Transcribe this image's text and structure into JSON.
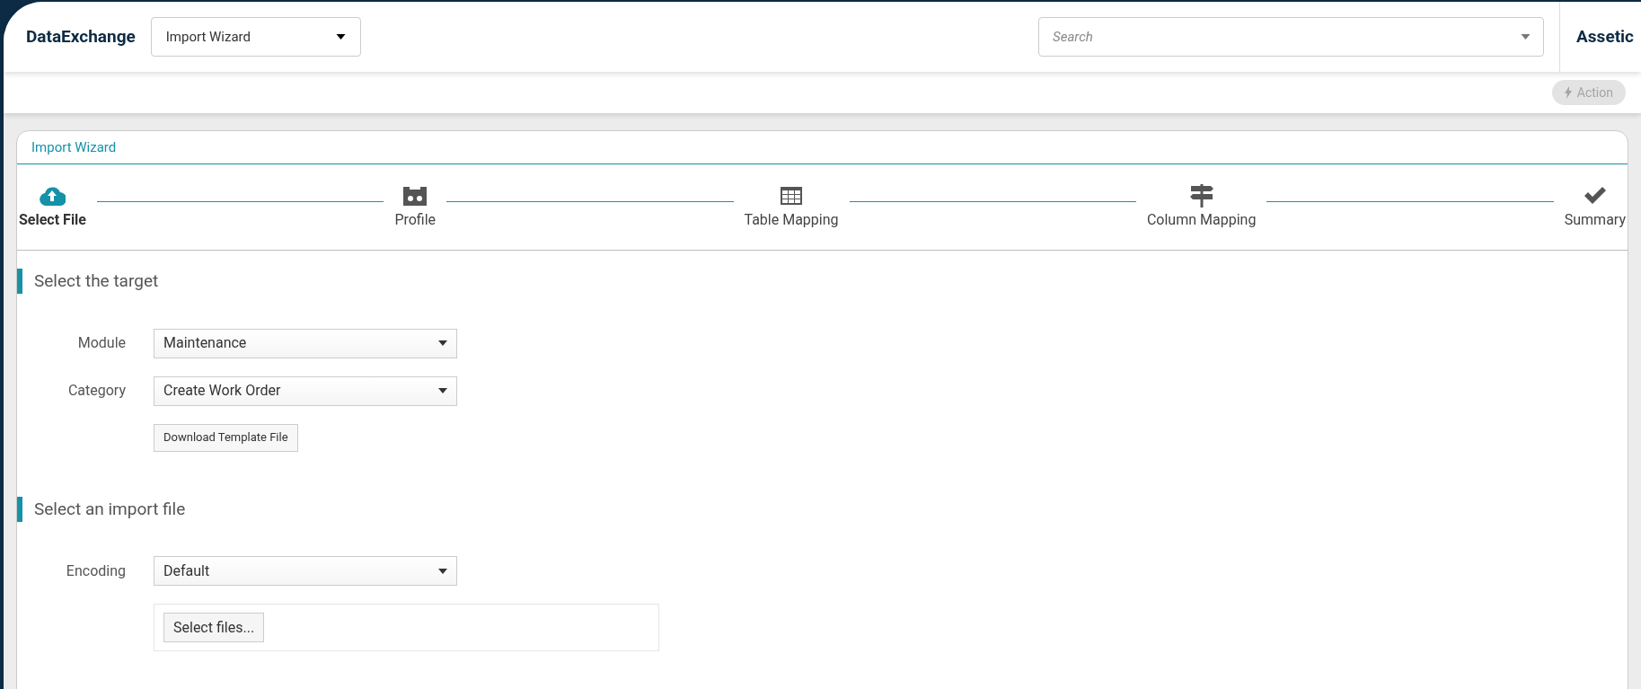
{
  "header": {
    "app_name": "DataExchange",
    "view_select": {
      "value": "Import Wizard"
    },
    "search": {
      "placeholder": "Search"
    },
    "brand": "Assetic"
  },
  "toolbar": {
    "action_button": {
      "label": "Action",
      "disabled": true
    }
  },
  "wizard": {
    "title": "Import Wizard",
    "steps": [
      {
        "label": "Select File",
        "kind": "upload",
        "selected": true
      },
      {
        "label": "Profile",
        "kind": "profile",
        "selected": false
      },
      {
        "label": "Table Mapping",
        "kind": "table",
        "selected": false
      },
      {
        "label": "Column Mapping",
        "kind": "signpost",
        "selected": false
      },
      {
        "label": "Summary",
        "kind": "check",
        "selected": false
      }
    ],
    "sections": [
      {
        "title": "Select the target",
        "fields": [
          {
            "kind": "select",
            "label": "Module",
            "value": "Maintenance"
          },
          {
            "kind": "select",
            "label": "Category",
            "value": "Create Work Order"
          },
          {
            "kind": "button",
            "label": "Download Template File"
          }
        ]
      },
      {
        "title": "Select an import file",
        "fields": [
          {
            "kind": "select",
            "label": "Encoding",
            "value": "Default"
          },
          {
            "kind": "upload",
            "label": "Select files..."
          }
        ]
      }
    ]
  }
}
